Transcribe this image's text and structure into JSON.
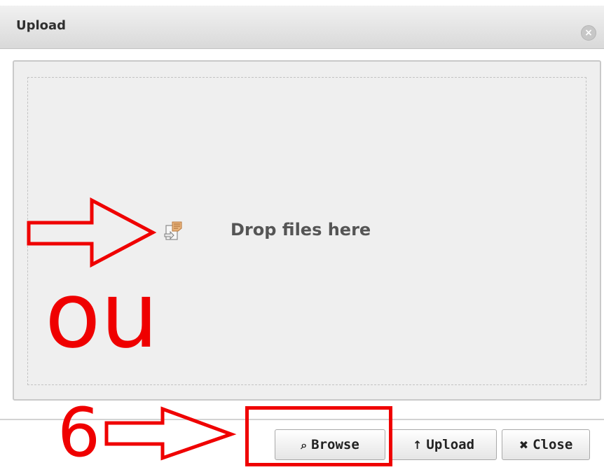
{
  "dialog": {
    "title": "Upload",
    "close_icon": "close-circle-icon"
  },
  "dropzone": {
    "text": "Drop files here",
    "icon": "file-drop-icon"
  },
  "buttons": [
    {
      "label": "Browse",
      "icon": "search-icon",
      "glyph": "⌕"
    },
    {
      "label": "Upload",
      "icon": "arrow-up-icon",
      "glyph": "↑"
    },
    {
      "label": "Close",
      "icon": "close-icon",
      "glyph": "✖"
    }
  ],
  "annotations": {
    "ou": "ou",
    "step": "6",
    "color": "#ef0000"
  },
  "colors": {
    "titlebar": "#e3e3e3",
    "panel": "#efefef",
    "accent_annotation": "#ef0000"
  }
}
